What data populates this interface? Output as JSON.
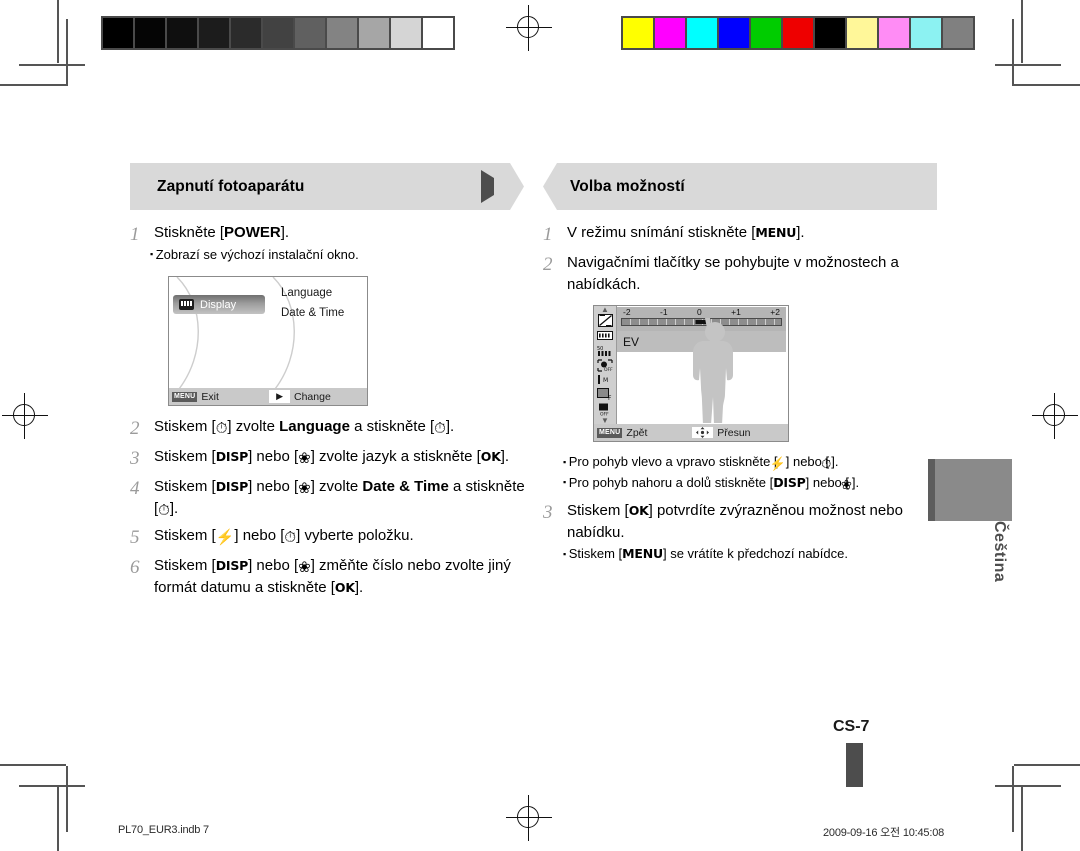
{
  "document": {
    "page_number": "CS-7",
    "language_tab": "Čeština",
    "footer_left": "PL70_EUR3.indb   7",
    "footer_right": "2009-09-16   오전 10:45:08"
  },
  "calibration": {
    "grayscale_label": "grayscale-strip",
    "grayscale": [
      "#000000",
      "#050505",
      "#0f0f0f",
      "#1c1c1c",
      "#2b2b2b",
      "#424242",
      "#606060",
      "#838383",
      "#a6a6a6",
      "#d5d5d5",
      "#ffffff"
    ],
    "color_label": "color-strip",
    "colors": [
      "#ffff00",
      "#ff00ff",
      "#00ffff",
      "#0000ff",
      "#00cc00",
      "#ee0000",
      "#000000",
      "#fff799",
      "#ff8cf5",
      "#8cf2f2",
      "#808080"
    ]
  },
  "left_section": {
    "title": "Zapnutí fotoaparátu",
    "marker": "triangle-right-icon",
    "steps": [
      {
        "num": "1",
        "text_html": "Stiskněte [<span class=\"b\">POWER</span>].",
        "notes": [
          "Zobrazí se výchozí instalační okno."
        ]
      },
      {
        "num": "2",
        "text_html": "Stiskem [<span class=\"gl\">&#9201;</span>] zvolte <span class=\"b\">Language</span> a stiskněte [<span class=\"gl\">&#9201;</span>].",
        "notes": []
      },
      {
        "num": "3",
        "text_html": "Stiskem [<span class=\"key\">DISP</span>] nebo [<span class=\"gl\">&#10048;</span>] zvolte jazyk a stiskněte [<span class=\"key\">OK</span>].",
        "notes": []
      },
      {
        "num": "4",
        "text_html": "Stiskem [<span class=\"key\">DISP</span>] nebo [<span class=\"gl\">&#10048;</span>] zvolte <span class=\"b\">Date &amp; Time</span> a stiskněte [<span class=\"gl\">&#9201;</span>].",
        "notes": []
      },
      {
        "num": "5",
        "text_html": "Stiskem [<span class=\"gl\">&#9889;</span>] nebo [<span class=\"gl\">&#9201;</span>] vyberte položku.",
        "notes": []
      },
      {
        "num": "6",
        "text_html": "Stiskem [<span class=\"key\">DISP</span>] nebo [<span class=\"gl\">&#10048;</span>] změňte číslo nebo zvolte jiný formát datumu a stiskněte [<span class=\"key\">OK</span>].",
        "notes": []
      }
    ],
    "lcd": {
      "highlighted_item": "Display",
      "highlight_icon": "display-icon",
      "options": [
        "Language",
        "Date & Time"
      ],
      "bottom_bar": {
        "menu_chip": "MENU",
        "left_label": "Exit",
        "right_icon": "play-right-icon",
        "right_label": "Change"
      }
    }
  },
  "right_section": {
    "title": "Volba možností",
    "marker": "square-icon",
    "steps": [
      {
        "num": "1",
        "text_html": "V režimu snímání stiskněte [<span class=\"key\">MENU</span>].",
        "notes": []
      },
      {
        "num": "2",
        "text_html": "Navigačními tlačítky se pohybujte v možnostech a nabídkách.",
        "notes": [
          "Pro pohyb vlevo a vpravo stiskněte [<span class=\"gl\">&#9889;</span>] nebo [<span class=\"gl\">&#9201;</span>].",
          "Pro pohyb nahoru a dolů stiskněte [<span class=\"key\">DISP</span>] nebo [<span class=\"gl\">&#10048;</span>]."
        ]
      },
      {
        "num": "3",
        "text_html": "Stiskem [<span class=\"key\">OK</span>] potvrdíte zvýrazněnou možnost nebo nabídku.",
        "notes": [
          "Stiskem [<span class=\"key\">MENU</span>] se vrátíte k předchozí nabídce."
        ]
      }
    ],
    "lcd": {
      "ev_ticks": [
        "-2",
        "-1",
        "0",
        "+1",
        "+2"
      ],
      "ev_marker_value": "0",
      "ev_label": "EV",
      "rail_icons": [
        "exposure-value-icon",
        "iso-icon",
        "white-balance-icon",
        "face-detection-off-icon",
        "focus-area-icon",
        "image-quality-f-icon",
        "flash-off-icon"
      ],
      "bottom_bar": {
        "menu_chip": "MENU",
        "left_label": "Zpět",
        "right_icon": "navigation-pad-icon",
        "right_label": "Přesun"
      }
    }
  }
}
